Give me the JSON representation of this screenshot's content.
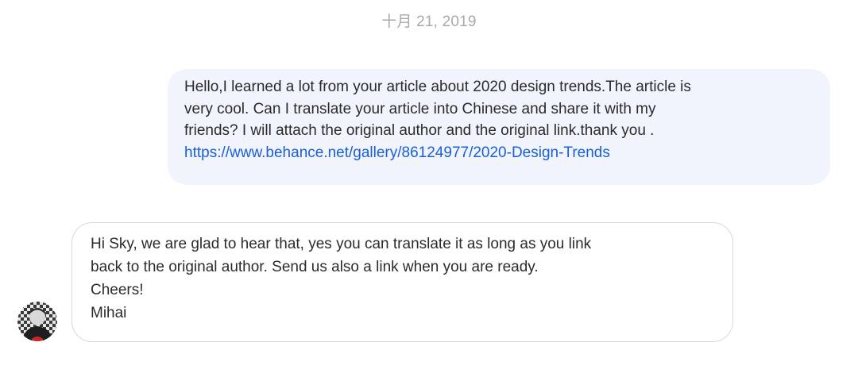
{
  "conversation": {
    "date": "十月 21, 2019",
    "messages": [
      {
        "direction": "outgoing",
        "text": "Hello,I learned a lot from your article about 2020 design trends.The article is\nvery cool. Can I translate your article into Chinese and share it with my\nfriends? I will attach the original author and the original link.thank you .",
        "link": "https://www.behance.net/gallery/86124977/2020-Design-Trends"
      },
      {
        "direction": "incoming",
        "text": "Hi Sky, we are glad to hear that, yes you can translate it as long as you link\nback to the original author. Send us also a link when you are ready.\nCheers!\nMihai"
      }
    ]
  },
  "colors": {
    "outgoing_bubble": "#f1f4fd",
    "incoming_bubble_border": "#d9d9d9",
    "link": "#1a5fd8",
    "date_text": "#a9a9a9"
  }
}
